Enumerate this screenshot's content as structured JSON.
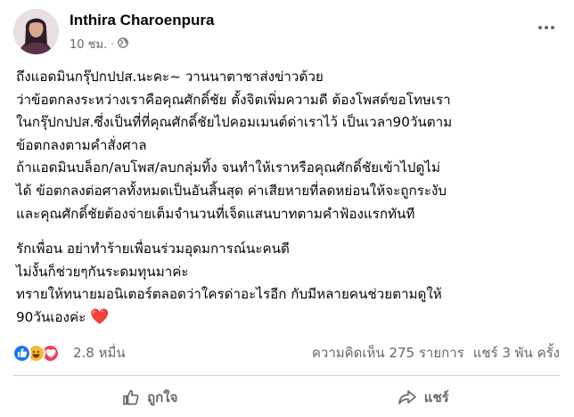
{
  "post": {
    "author": "Inthira Charoenpura",
    "time": "10 ชม.",
    "separator": "·",
    "paragraphs": [
      [
        "ถึงแอดมินกรุ๊ปกปปส.นะคะ~ วานนาตาชาส่งข่าวด้วย",
        "ว่าข้อตกลงระหว่างเราคือคุณศักดิ์ชัย ตั้งจิตเพิ่มความดี ต้องโพสต์ขอโทษเรา",
        "ในกรุ๊ปกปปส.ซึ่งเป็นที่ที่คุณศักดิ์ชัยไปคอมเมนต์ด่าเราไว้ เป็นเวลา90วันตาม",
        "ข้อตกลงตามคำสั่งศาล",
        "ถ้าแอดมินบล็อก/ลบโพส/ลบกลุ่มทิ้ง จนทำให้เราหรือคุณศักดิ์ชัยเข้าไปดูไม่",
        "ได้ ข้อตกลงต่อศาลทั้งหมดเป็นอันสิ้นสุด ค่าเสียหายที่ลดหย่อนให้จะถูกระงับ",
        "และคุณศักดิ์ชัยต้องจ่ายเต็มจำนวนที่เจ็ดแสนบาทตามคำฟ้องแรกทันที"
      ],
      [
        "รักเพื่อน อย่าทำร้ายเพื่อนร่วมอุดมการณ์นะคนดี",
        "ไม่งั้นก็ช่วยๆกันระดมทุนมาค่ะ",
        "ทรายให้ทนายมอนิเตอร์ตลอดว่าใครด่าอะไรอีก กับมีหลายคนช่วยตามดูให้",
        "90วันเองค่ะ"
      ]
    ],
    "heart_emoji": "❤️"
  },
  "stats": {
    "reaction_count": "2.8 หมื่น",
    "comments": "ความคิดเห็น 275 รายการ",
    "shares": "แชร์ 3 พัน ครั้ง"
  },
  "actions": {
    "like_label": "ถูกใจ",
    "share_label": "แชร์"
  },
  "colors": {
    "like_blue": "#1877f2",
    "haha_yellow": "#f7b928",
    "love_red": "#f33e58",
    "secondary_text": "#65676b",
    "heart": "#f02849"
  },
  "icons": {
    "privacy": "globe-icon",
    "more": "more-horizontal-icon",
    "like_action": "thumbs-up-icon",
    "share_action": "share-arrow-icon"
  }
}
